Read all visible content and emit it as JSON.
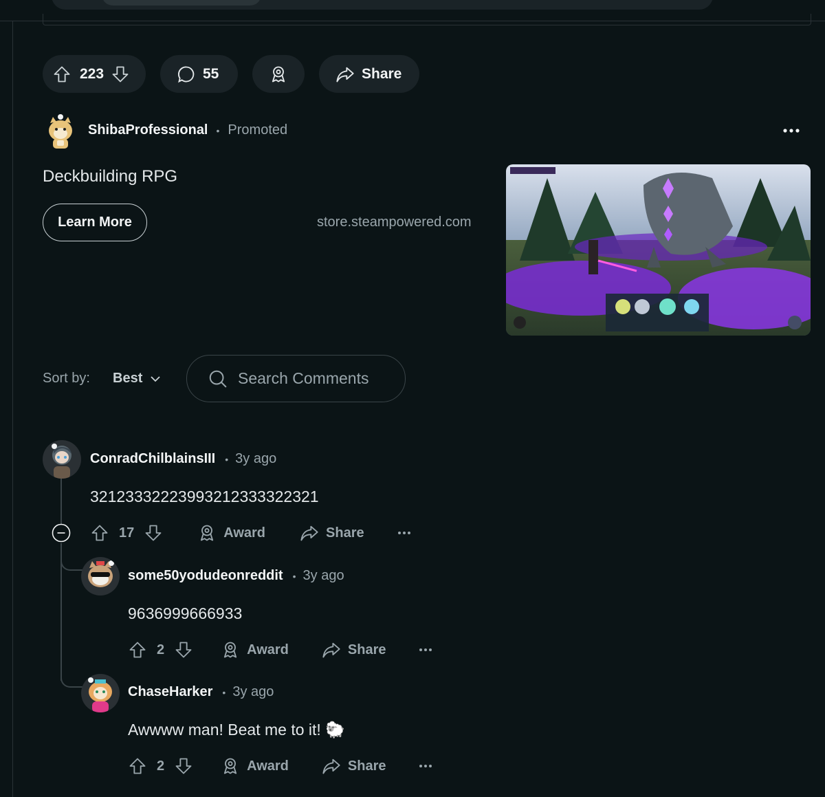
{
  "post_actions": {
    "vote_count": "223",
    "comment_count": "55",
    "share_label": "Share"
  },
  "ad": {
    "username": "ShibaProfessional",
    "separator": "•",
    "promoted_label": "Promoted",
    "headline": "Deckbuilding RPG",
    "cta_label": "Learn More",
    "domain": "store.steampowered.com"
  },
  "sort": {
    "label": "Sort by:",
    "value": "Best"
  },
  "search": {
    "placeholder": "Search Comments"
  },
  "comments": [
    {
      "username": "ConradChilblainsIII",
      "separator": "•",
      "time": "3y ago",
      "body": "32123332223993212333322321",
      "votes": "17",
      "award_label": "Award",
      "share_label": "Share"
    },
    {
      "username": "some50yodudeonreddit",
      "separator": "•",
      "time": "3y ago",
      "body": "9636999666933",
      "votes": "2",
      "award_label": "Award",
      "share_label": "Share"
    },
    {
      "username": "ChaseHarker",
      "separator": "•",
      "time": "3y ago",
      "body": "Awwww man! Beat me to it! 🐑",
      "votes": "2",
      "award_label": "Award",
      "share_label": "Share"
    }
  ],
  "colors": {
    "background": "#0b1416",
    "pill": "#1a2327",
    "muted_text": "#9aa6ac",
    "accent_purple": "#a13bff"
  },
  "icons": [
    "upvote-icon",
    "downvote-icon",
    "comment-icon",
    "award-icon",
    "share-icon",
    "more-icon",
    "search-icon",
    "chevron-down-icon",
    "collapse-icon"
  ]
}
